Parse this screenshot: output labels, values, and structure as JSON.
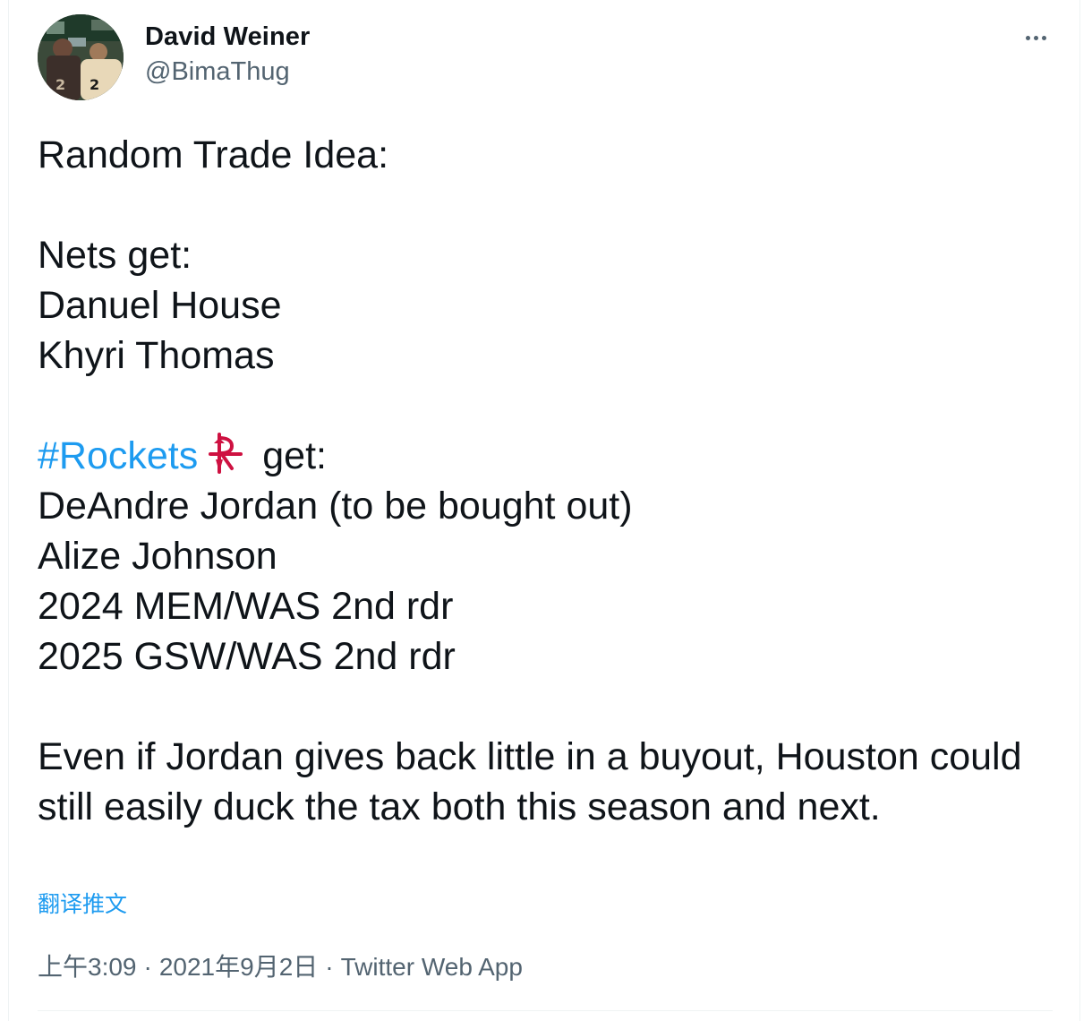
{
  "tweet": {
    "author": {
      "display_name": "David Weiner",
      "handle": "@BimaThug",
      "avatar_icon": "avatar-photo"
    },
    "more_icon": "more-options-icon",
    "lines": {
      "l1": "Random Trade Idea:",
      "l2": "Nets get:",
      "l3": "Danuel House",
      "l4": "Khyri Thomas",
      "hashtag": "#Rockets",
      "hashtag_emoji": "rockets-logo-icon",
      "l5_rest": "get:",
      "l6": "DeAndre Jordan (to be bought out)",
      "l7": "Alize Johnson",
      "l8": "2024 MEM/WAS 2nd rdr",
      "l9": "2025 GSW/WAS 2nd rdr",
      "l10": "Even if Jordan gives back little in a buyout, Houston could still easily duck the tax both this season and next."
    },
    "translate_label": "翻译推文",
    "meta": {
      "time": "上午3:09",
      "separator": "·",
      "date": "2021年9月2日",
      "app": "Twitter Web App"
    },
    "colors": {
      "link": "#1d9bf0",
      "text": "#0f1419",
      "secondary": "#536471",
      "rockets_red": "#ce1141"
    }
  }
}
